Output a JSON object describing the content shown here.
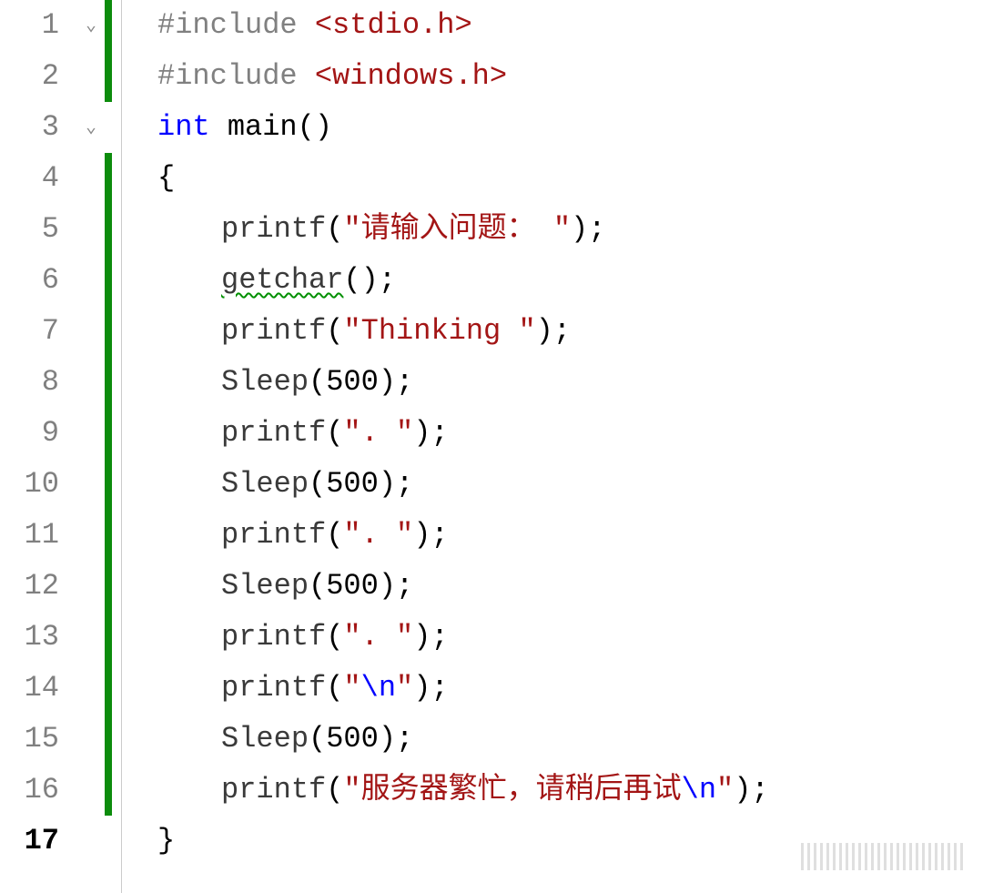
{
  "lines": [
    {
      "n": "1",
      "fold": true,
      "change": true,
      "indent": 1,
      "tokens": [
        {
          "t": "#include ",
          "c": "directive"
        },
        {
          "t": "<stdio.h>",
          "c": "incstr"
        }
      ]
    },
    {
      "n": "2",
      "fold": false,
      "change": true,
      "indent": 1,
      "tokens": [
        {
          "t": "#include ",
          "c": "directive"
        },
        {
          "t": "<windows.h>",
          "c": "incstr"
        }
      ]
    },
    {
      "n": "3",
      "fold": true,
      "change": false,
      "indent": 0,
      "tokens": [
        {
          "t": "int",
          "c": "keyword"
        },
        {
          "t": " main()",
          "c": "fname"
        }
      ]
    },
    {
      "n": "4",
      "fold": false,
      "change": true,
      "indent": 0,
      "tokens": [
        {
          "t": "{",
          "c": "brace"
        }
      ]
    },
    {
      "n": "5",
      "fold": false,
      "change": true,
      "indent": 2,
      "tokens": [
        {
          "t": "printf",
          "c": "callname"
        },
        {
          "t": "(",
          "c": "punct"
        },
        {
          "t": "\"请输入问题： \"",
          "c": "string"
        },
        {
          "t": ");",
          "c": "punct"
        }
      ]
    },
    {
      "n": "6",
      "fold": false,
      "change": true,
      "indent": 2,
      "tokens": [
        {
          "t": "getchar",
          "c": "callname warn-underline"
        },
        {
          "t": "();",
          "c": "punct"
        }
      ]
    },
    {
      "n": "7",
      "fold": false,
      "change": true,
      "indent": 2,
      "tokens": [
        {
          "t": "printf",
          "c": "callname"
        },
        {
          "t": "(",
          "c": "punct"
        },
        {
          "t": "\"Thinking \"",
          "c": "string"
        },
        {
          "t": ");",
          "c": "punct"
        }
      ]
    },
    {
      "n": "8",
      "fold": false,
      "change": true,
      "indent": 2,
      "tokens": [
        {
          "t": "Sleep",
          "c": "callname"
        },
        {
          "t": "(",
          "c": "punct"
        },
        {
          "t": "500",
          "c": "num"
        },
        {
          "t": ");",
          "c": "punct"
        }
      ]
    },
    {
      "n": "9",
      "fold": false,
      "change": true,
      "indent": 2,
      "tokens": [
        {
          "t": "printf",
          "c": "callname"
        },
        {
          "t": "(",
          "c": "punct"
        },
        {
          "t": "\". \"",
          "c": "string"
        },
        {
          "t": ");",
          "c": "punct"
        }
      ]
    },
    {
      "n": "10",
      "fold": false,
      "change": true,
      "indent": 2,
      "tokens": [
        {
          "t": "Sleep",
          "c": "callname"
        },
        {
          "t": "(",
          "c": "punct"
        },
        {
          "t": "500",
          "c": "num"
        },
        {
          "t": ");",
          "c": "punct"
        }
      ]
    },
    {
      "n": "11",
      "fold": false,
      "change": true,
      "indent": 2,
      "tokens": [
        {
          "t": "printf",
          "c": "callname"
        },
        {
          "t": "(",
          "c": "punct"
        },
        {
          "t": "\". \"",
          "c": "string"
        },
        {
          "t": ");",
          "c": "punct"
        }
      ]
    },
    {
      "n": "12",
      "fold": false,
      "change": true,
      "indent": 2,
      "tokens": [
        {
          "t": "Sleep",
          "c": "callname"
        },
        {
          "t": "(",
          "c": "punct"
        },
        {
          "t": "500",
          "c": "num"
        },
        {
          "t": ");",
          "c": "punct"
        }
      ]
    },
    {
      "n": "13",
      "fold": false,
      "change": true,
      "indent": 2,
      "tokens": [
        {
          "t": "printf",
          "c": "callname"
        },
        {
          "t": "(",
          "c": "punct"
        },
        {
          "t": "\". \"",
          "c": "string"
        },
        {
          "t": ");",
          "c": "punct"
        }
      ]
    },
    {
      "n": "14",
      "fold": false,
      "change": true,
      "indent": 2,
      "tokens": [
        {
          "t": "printf",
          "c": "callname"
        },
        {
          "t": "(",
          "c": "punct"
        },
        {
          "t": "\"",
          "c": "string"
        },
        {
          "t": "\\n",
          "c": "escape"
        },
        {
          "t": "\"",
          "c": "string"
        },
        {
          "t": ");",
          "c": "punct"
        }
      ]
    },
    {
      "n": "15",
      "fold": false,
      "change": true,
      "indent": 2,
      "tokens": [
        {
          "t": "Sleep",
          "c": "callname"
        },
        {
          "t": "(",
          "c": "punct"
        },
        {
          "t": "500",
          "c": "num"
        },
        {
          "t": ");",
          "c": "punct"
        }
      ]
    },
    {
      "n": "16",
      "fold": false,
      "change": true,
      "indent": 2,
      "tokens": [
        {
          "t": "printf",
          "c": "callname"
        },
        {
          "t": "(",
          "c": "punct"
        },
        {
          "t": "\"服务器繁忙，请稍后再试",
          "c": "string"
        },
        {
          "t": "\\n",
          "c": "escape"
        },
        {
          "t": "\"",
          "c": "string"
        },
        {
          "t": ");",
          "c": "punct"
        }
      ]
    },
    {
      "n": "17",
      "fold": false,
      "change": false,
      "indent": 0,
      "tokens": [
        {
          "t": "}",
          "c": "brace"
        }
      ],
      "boldnum": true
    }
  ],
  "chevron_glyph": "⌄"
}
